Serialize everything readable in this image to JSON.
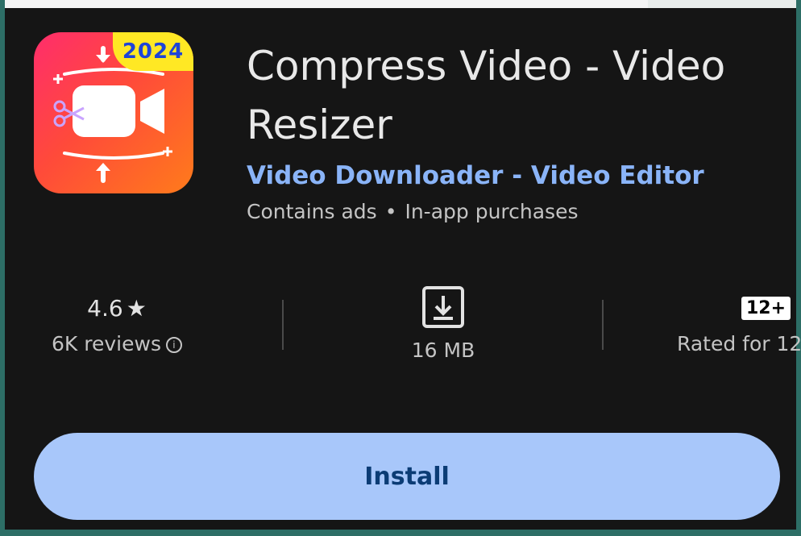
{
  "app": {
    "title": "Compress Video - Video Resizer",
    "developer": "Video Downloader - Video Editor",
    "contains_ads": "Contains ads",
    "separator": "•",
    "in_app": "In-app purchases",
    "icon_badge": "2024"
  },
  "stats": {
    "rating_value": "4.6",
    "rating_star": "★",
    "reviews": "6K reviews",
    "info_glyph": "i",
    "size_label": "16 MB",
    "age_badge": "12+",
    "age_label": "Rated for 12"
  },
  "install": {
    "label": "Install"
  },
  "colors": {
    "background": "#151515",
    "accent": "#a8c7fa",
    "developer_link": "#8ab4f8",
    "badge_yellow": "#ffe824"
  },
  "icons": {
    "app_icon": "video-camera-compress-icon",
    "star": "star-icon",
    "download": "download-box-icon",
    "info": "info-icon"
  }
}
